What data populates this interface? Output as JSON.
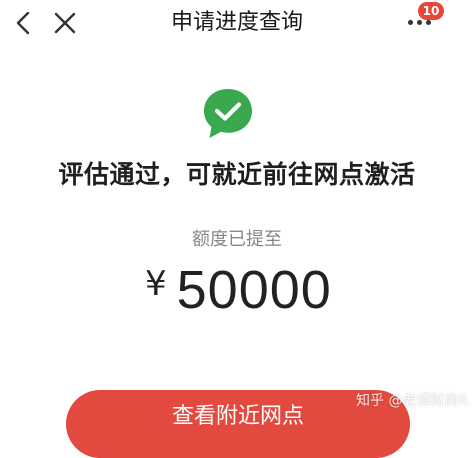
{
  "nav": {
    "title": "申请进度查询",
    "back_icon": "chevron-left-icon",
    "close_icon": "close-icon",
    "more_icon": "more-dots-icon",
    "badge_count": "10"
  },
  "result": {
    "icon": "check-chat-bubble-icon",
    "title": "评估通过，可就近前往网点激活",
    "limit_label": "额度已提至",
    "currency_symbol": "¥",
    "amount": "50000"
  },
  "action": {
    "button_label": "查看附近网点"
  },
  "watermark": {
    "text": "知乎 @老谭财商R"
  },
  "colors": {
    "accent_red": "#e34a3f",
    "success_green": "#3aa84f",
    "badge_red": "#e8463a"
  }
}
